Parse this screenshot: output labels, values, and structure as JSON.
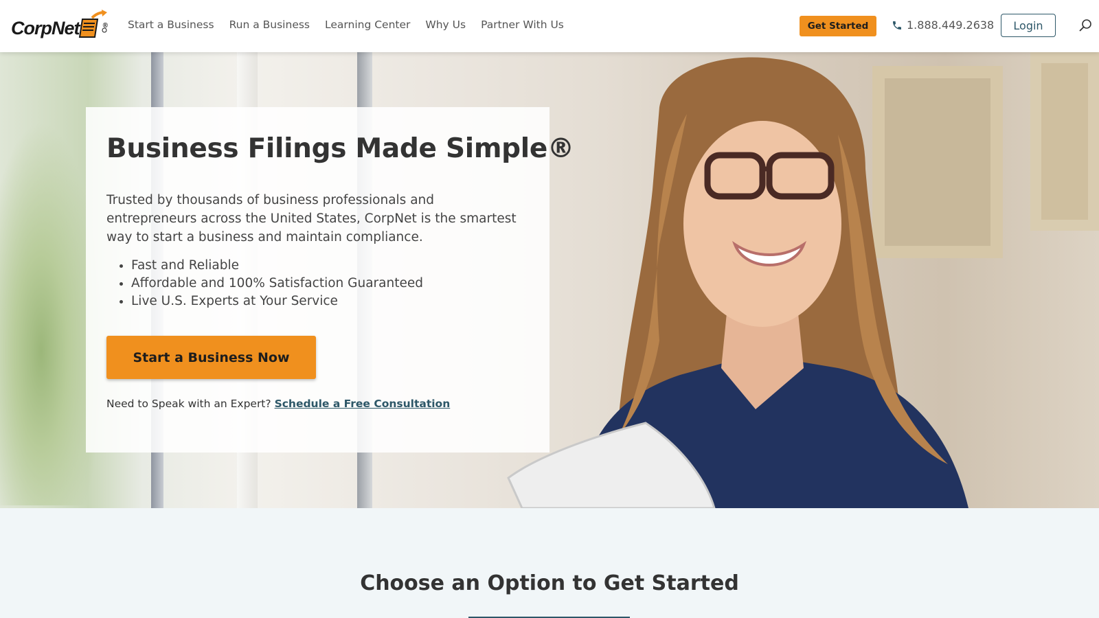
{
  "brand": {
    "name": "CorpNet",
    "trademark": "®"
  },
  "nav": {
    "items": [
      {
        "label": "Start a Business"
      },
      {
        "label": "Run a Business"
      },
      {
        "label": "Learning Center"
      },
      {
        "label": "Why Us"
      },
      {
        "label": "Partner With Us"
      }
    ],
    "get_started_label": "Get Started",
    "phone": "1.888.449.2638",
    "login_label": "Login",
    "icons": {
      "phone": "phone-icon",
      "search": "search-icon"
    }
  },
  "hero": {
    "title": "Business Filings Made Simple®",
    "description": "Trusted by thousands of business professionals and entrepreneurs across the United States, CorpNet is the smartest way to start a business and maintain compliance.",
    "bullets": [
      "Fast and Reliable",
      "Affordable and 100% Satisfaction Guaranteed",
      "Live U.S. Experts at Your Service"
    ],
    "cta_label": "Start a Business Now",
    "consult_prompt": "Need to Speak with an Expert?",
    "consult_link": "Schedule a Free Consultation"
  },
  "options": {
    "title": "Choose an Option to Get Started"
  },
  "colors": {
    "accent_orange": "#f0901e",
    "brand_teal": "#2d5768",
    "text_dark": "#333333",
    "section_bg": "#f1f6f8"
  }
}
